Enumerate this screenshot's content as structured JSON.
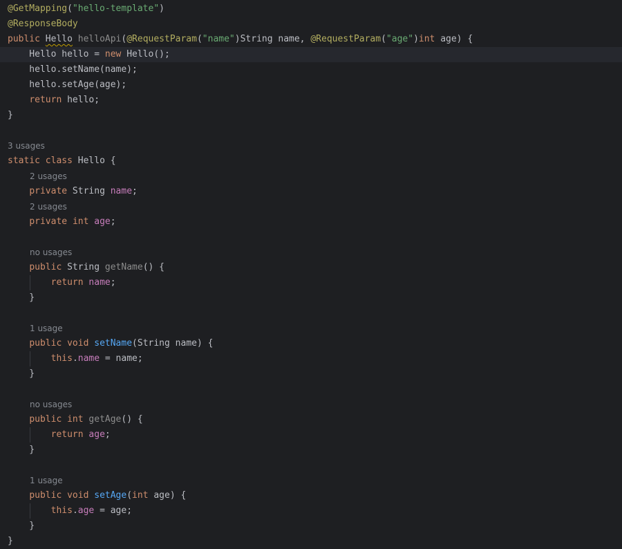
{
  "editor": {
    "language": "java",
    "theme": {
      "background": "#1e1f22",
      "keyword": "#cf8e6d",
      "annotation": "#b3ae60",
      "string": "#6aab73",
      "method_declaration": "#56a8f5",
      "field": "#c77dbb",
      "plain_text": "#bcbec4",
      "inlay_hint": "#868a91"
    },
    "lines": [
      {
        "tokens": [
          {
            "t": "@GetMapping",
            "c": "a"
          },
          {
            "t": "("
          },
          {
            "t": "\"hello-template\"",
            "c": "s"
          },
          {
            "t": ")"
          }
        ]
      },
      {
        "tokens": [
          {
            "t": "@ResponseBody",
            "c": "a"
          }
        ]
      },
      {
        "tokens": [
          {
            "t": "public",
            "c": "k"
          },
          {
            "t": " "
          },
          {
            "t": "Hello",
            "c": "sq"
          },
          {
            "t": " "
          },
          {
            "t": "helloApi",
            "c": "u"
          },
          {
            "t": "("
          },
          {
            "t": "@RequestParam",
            "c": "a"
          },
          {
            "t": "("
          },
          {
            "t": "\"name\"",
            "c": "s"
          },
          {
            "t": ")String name, "
          },
          {
            "t": "@RequestParam",
            "c": "a"
          },
          {
            "t": "("
          },
          {
            "t": "\"age\"",
            "c": "s"
          },
          {
            "t": ")"
          },
          {
            "t": "int",
            "c": "k"
          },
          {
            "t": " age) {"
          }
        ]
      },
      {
        "current": true,
        "tokens": [
          {
            "t": "    Hello hello = "
          },
          {
            "t": "new",
            "c": "k"
          },
          {
            "t": " Hello();"
          }
        ]
      },
      {
        "tokens": [
          {
            "t": "    hello.setName(name);"
          }
        ]
      },
      {
        "tokens": [
          {
            "t": "    hello.setAge(age);"
          }
        ]
      },
      {
        "tokens": [
          {
            "t": "    "
          },
          {
            "t": "return",
            "c": "k"
          },
          {
            "t": " hello;"
          }
        ]
      },
      {
        "tokens": [
          {
            "t": "}"
          }
        ]
      },
      {
        "tokens": []
      },
      {
        "hint": "3 usages",
        "tokens": [
          {
            "t": "static",
            "c": "k"
          },
          {
            "t": " "
          },
          {
            "t": "class",
            "c": "k"
          },
          {
            "t": " Hello {"
          }
        ]
      },
      {
        "hint": "2 usages",
        "indent": 1,
        "tokens": [
          {
            "t": "    "
          },
          {
            "t": "private",
            "c": "k"
          },
          {
            "t": " String "
          },
          {
            "t": "name",
            "c": "fd"
          },
          {
            "t": ";"
          }
        ]
      },
      {
        "hint": "2 usages",
        "indent": 1,
        "tokens": [
          {
            "t": "    "
          },
          {
            "t": "private",
            "c": "k"
          },
          {
            "t": " "
          },
          {
            "t": "int",
            "c": "k"
          },
          {
            "t": " "
          },
          {
            "t": "age",
            "c": "fd"
          },
          {
            "t": ";"
          }
        ]
      },
      {
        "tokens": []
      },
      {
        "hint": "no usages",
        "indent": 1,
        "tokens": [
          {
            "t": "    "
          },
          {
            "t": "public",
            "c": "k"
          },
          {
            "t": " String "
          },
          {
            "t": "getName",
            "c": "u"
          },
          {
            "t": "() {"
          }
        ]
      },
      {
        "tokens": [
          {
            "t": "        "
          },
          {
            "t": "return",
            "c": "k"
          },
          {
            "t": " "
          },
          {
            "t": "name",
            "c": "fd"
          },
          {
            "t": ";"
          }
        ]
      },
      {
        "tokens": [
          {
            "t": "    }"
          }
        ]
      },
      {
        "tokens": []
      },
      {
        "hint": "1 usage",
        "indent": 1,
        "tokens": [
          {
            "t": "    "
          },
          {
            "t": "public",
            "c": "k"
          },
          {
            "t": " "
          },
          {
            "t": "void",
            "c": "k"
          },
          {
            "t": " "
          },
          {
            "t": "setName",
            "c": "f"
          },
          {
            "t": "(String name) {"
          }
        ]
      },
      {
        "tokens": [
          {
            "t": "        "
          },
          {
            "t": "this",
            "c": "k"
          },
          {
            "t": "."
          },
          {
            "t": "name",
            "c": "fd"
          },
          {
            "t": " = name;"
          }
        ]
      },
      {
        "tokens": [
          {
            "t": "    }"
          }
        ]
      },
      {
        "tokens": []
      },
      {
        "hint": "no usages",
        "indent": 1,
        "tokens": [
          {
            "t": "    "
          },
          {
            "t": "public",
            "c": "k"
          },
          {
            "t": " "
          },
          {
            "t": "int",
            "c": "k"
          },
          {
            "t": " "
          },
          {
            "t": "getAge",
            "c": "u"
          },
          {
            "t": "() {"
          }
        ]
      },
      {
        "tokens": [
          {
            "t": "        "
          },
          {
            "t": "return",
            "c": "k"
          },
          {
            "t": " "
          },
          {
            "t": "age",
            "c": "fd"
          },
          {
            "t": ";"
          }
        ]
      },
      {
        "tokens": [
          {
            "t": "    }"
          }
        ]
      },
      {
        "tokens": []
      },
      {
        "hint": "1 usage",
        "indent": 1,
        "tokens": [
          {
            "t": "    "
          },
          {
            "t": "public",
            "c": "k"
          },
          {
            "t": " "
          },
          {
            "t": "void",
            "c": "k"
          },
          {
            "t": " "
          },
          {
            "t": "setAge",
            "c": "f"
          },
          {
            "t": "("
          },
          {
            "t": "int",
            "c": "k"
          },
          {
            "t": " age) {"
          }
        ]
      },
      {
        "tokens": [
          {
            "t": "        "
          },
          {
            "t": "this",
            "c": "k"
          },
          {
            "t": "."
          },
          {
            "t": "age",
            "c": "fd"
          },
          {
            "t": " = age;"
          }
        ]
      },
      {
        "tokens": [
          {
            "t": "    }"
          }
        ]
      },
      {
        "tokens": [
          {
            "t": "}"
          }
        ]
      }
    ]
  }
}
